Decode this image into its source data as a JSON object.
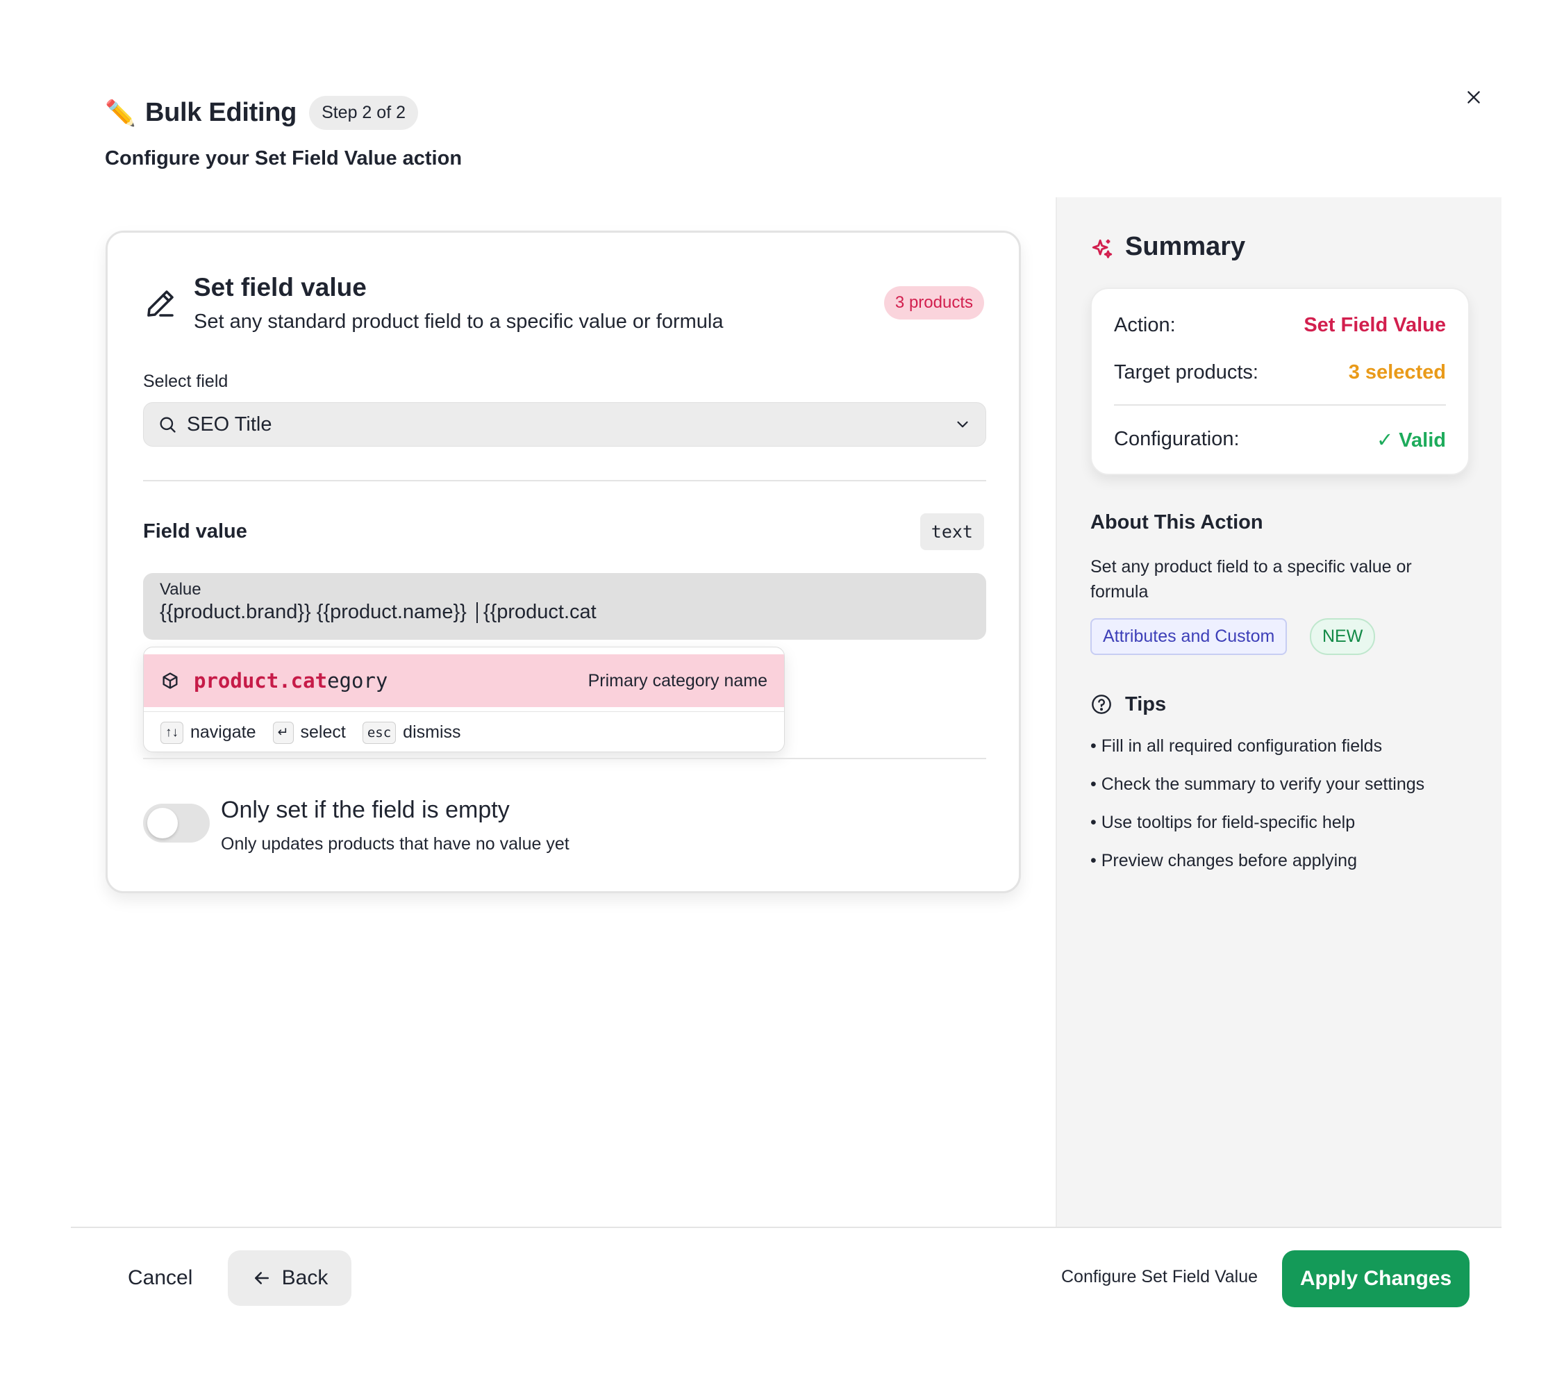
{
  "header": {
    "icon": "pencil-emoji",
    "title": "Bulk Editing",
    "step": "Step 2 of 2",
    "subtitle_prefix": "Configure your ",
    "subtitle_bold": "Set Field Value",
    "subtitle_suffix": " action"
  },
  "card": {
    "icon": "pen-icon",
    "title": "Set field value",
    "description": "Set any standard product field to a specific value or formula",
    "products_badge": "3 products",
    "select_label": "Select field",
    "select_value": "SEO Title",
    "field_value_label": "Field value",
    "type_tag": "text",
    "value_label": "Value",
    "value_text": "{{product.brand}} {{product.name}} | {{product.cat",
    "autocomplete": {
      "item_match": "product.cat",
      "item_rest": "egory",
      "item_desc": "Primary category name",
      "keys": [
        {
          "key": "↑↓",
          "label": "navigate"
        },
        {
          "key": "↵",
          "label": "select"
        },
        {
          "key": "esc",
          "label": "dismiss"
        }
      ]
    },
    "toggle_title": "Only set if the field is empty",
    "toggle_desc": "Only updates products that have no value yet",
    "toggle_on": false
  },
  "summary": {
    "title": "Summary",
    "rows": [
      {
        "label": "Action:",
        "value": "Set Field Value"
      },
      {
        "label": "Target products:",
        "value": "3 selected"
      },
      {
        "label": "Configuration:",
        "value": "✓ Valid"
      }
    ],
    "about_title": "About This Action",
    "about_desc": "Set any product field to a specific value or formula",
    "chip_attr": "Attributes and Custom",
    "chip_new": "NEW",
    "tips_title": "Tips",
    "tips": [
      "Fill in all required configuration fields",
      "Check the summary to verify your settings",
      "Use tooltips for field-specific help",
      "Preview changes before applying"
    ]
  },
  "footer": {
    "cancel": "Cancel",
    "back": "Back",
    "configure_text": "Configure Set Field Value",
    "apply": "Apply Changes"
  },
  "colors": {
    "accent_pink": "#d21f4e",
    "accent_orange": "#e99a19",
    "accent_green": "#1dab5b",
    "apply_green": "#149a58"
  }
}
